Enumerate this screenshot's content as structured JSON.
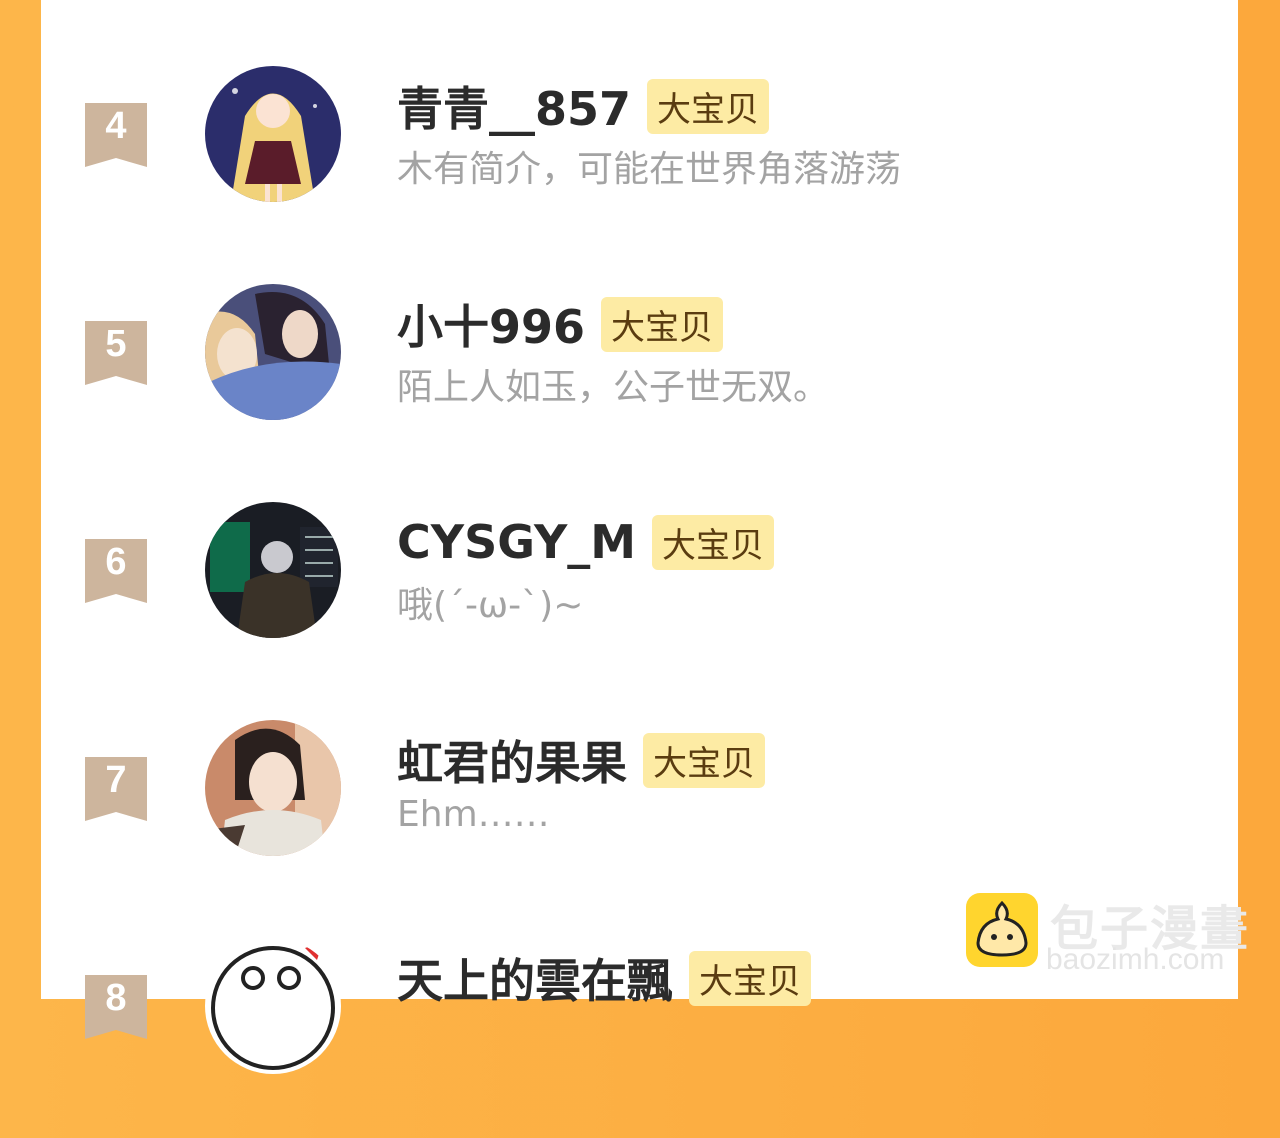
{
  "ranking": {
    "users": [
      {
        "rank": "4",
        "name": "青青__857",
        "badge": "大宝贝",
        "bio": "木有简介，可能在世界角落游荡",
        "avatar": "anime-girl-avatar"
      },
      {
        "rank": "5",
        "name": "小十996",
        "badge": "大宝贝",
        "bio": "陌上人如玉，公子世无双。",
        "avatar": "anime-couple-avatar"
      },
      {
        "rank": "6",
        "name": "CYSGY_M",
        "badge": "大宝贝",
        "bio": "哦(´-ω-`)~",
        "avatar": "game-character-avatar"
      },
      {
        "rank": "7",
        "name": "虹君的果果",
        "badge": "大宝贝",
        "bio": "Ehm……",
        "avatar": "ancient-style-avatar"
      },
      {
        "rank": "8",
        "name": "天上的雲在飄",
        "badge": "大宝贝",
        "bio": "",
        "avatar": "cartoon-face-avatar"
      }
    ]
  },
  "watermark": {
    "title": "包子漫畫",
    "domain": "baozimh.com"
  },
  "colors": {
    "border": "#fca83c",
    "badge_bg": "#fdeba4",
    "rank_bg": "#cdb59d"
  }
}
